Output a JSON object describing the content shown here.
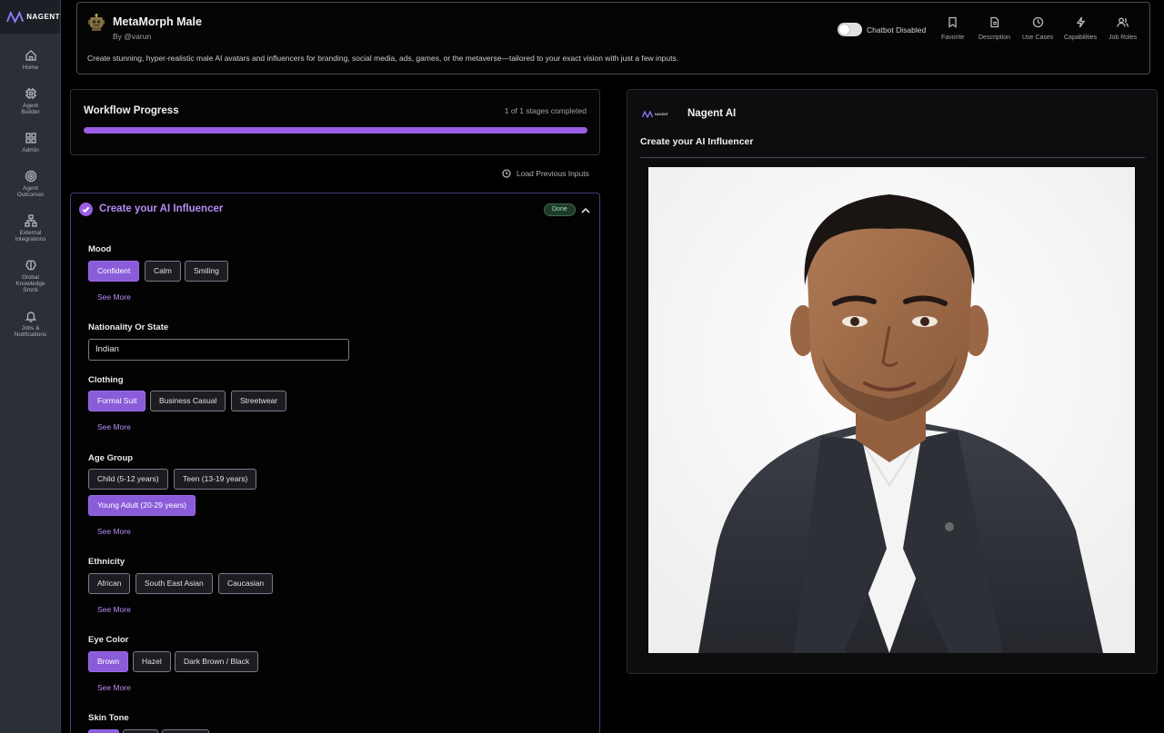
{
  "brand": {
    "name": "NAGENT"
  },
  "sidebar": {
    "items": [
      {
        "label": "Home",
        "icon": "home-icon"
      },
      {
        "label": "Agent Builder",
        "icon": "chip-icon"
      },
      {
        "label": "Admin",
        "icon": "grid-icon"
      },
      {
        "label": "Agent Outcomes",
        "icon": "target-icon"
      },
      {
        "label": "External Integrations",
        "icon": "network-icon"
      },
      {
        "label": "Global Knowledge Smriti",
        "icon": "brain-icon"
      },
      {
        "label": "Jobs & Notifications",
        "icon": "bell-icon"
      }
    ]
  },
  "header": {
    "title": "MetaMorph Male",
    "author": "By @varun",
    "description": "Create stunning, hyper-realistic male AI avatars and influencers for branding, social media, ads, games, or the metaverse—tailored to your exact vision with just a few inputs.",
    "chatbot_label": "Chatbot Disabled",
    "actions": [
      {
        "label": "Favorite",
        "icon": "bookmark-icon"
      },
      {
        "label": "Description",
        "icon": "document-icon"
      },
      {
        "label": "Use Cases",
        "icon": "clock-icon"
      },
      {
        "label": "Capabilities",
        "icon": "lightning-icon"
      },
      {
        "label": "Job Roles",
        "icon": "users-icon"
      }
    ]
  },
  "workflow": {
    "title": "Workflow Progress",
    "count": "1 of 1 stages completed",
    "progress": 1.0,
    "load_previous": "Load Previous Inputs"
  },
  "stage": {
    "title": "Create your AI Influencer",
    "status": "Done",
    "see_more": "See More",
    "fields": {
      "mood": {
        "label": "Mood",
        "options": [
          "Confident",
          "Calm",
          "Smiling"
        ],
        "selected": "Confident"
      },
      "nationality": {
        "label": "Nationality Or State",
        "value": "Indian"
      },
      "clothing": {
        "label": "Clothing",
        "options": [
          "Formal Suit",
          "Business Casual",
          "Streetwear"
        ],
        "selected": "Formal Suit"
      },
      "age_group": {
        "label": "Age Group",
        "options": [
          "Child (5-12 years)",
          "Teen (13-19 years)",
          "Young Adult (20-29 years)"
        ],
        "selected": "Young Adult (20-29 years)"
      },
      "ethnicity": {
        "label": "Ethnicity",
        "options": [
          "African",
          "South East Asian",
          "Caucasian"
        ],
        "selected": ""
      },
      "eye_color": {
        "label": "Eye Color",
        "options": [
          "Brown",
          "Hazel",
          "Dark Brown / Black"
        ],
        "selected": "Brown"
      },
      "skin_tone": {
        "label": "Skin Tone"
      }
    }
  },
  "output": {
    "agent_name": "Nagent AI",
    "heading": "Create your AI Influencer"
  },
  "colors": {
    "accent": "#9b5de5",
    "accent_text": "#b58cf5",
    "background": "#000000",
    "sidebar": "#2b2f38"
  }
}
